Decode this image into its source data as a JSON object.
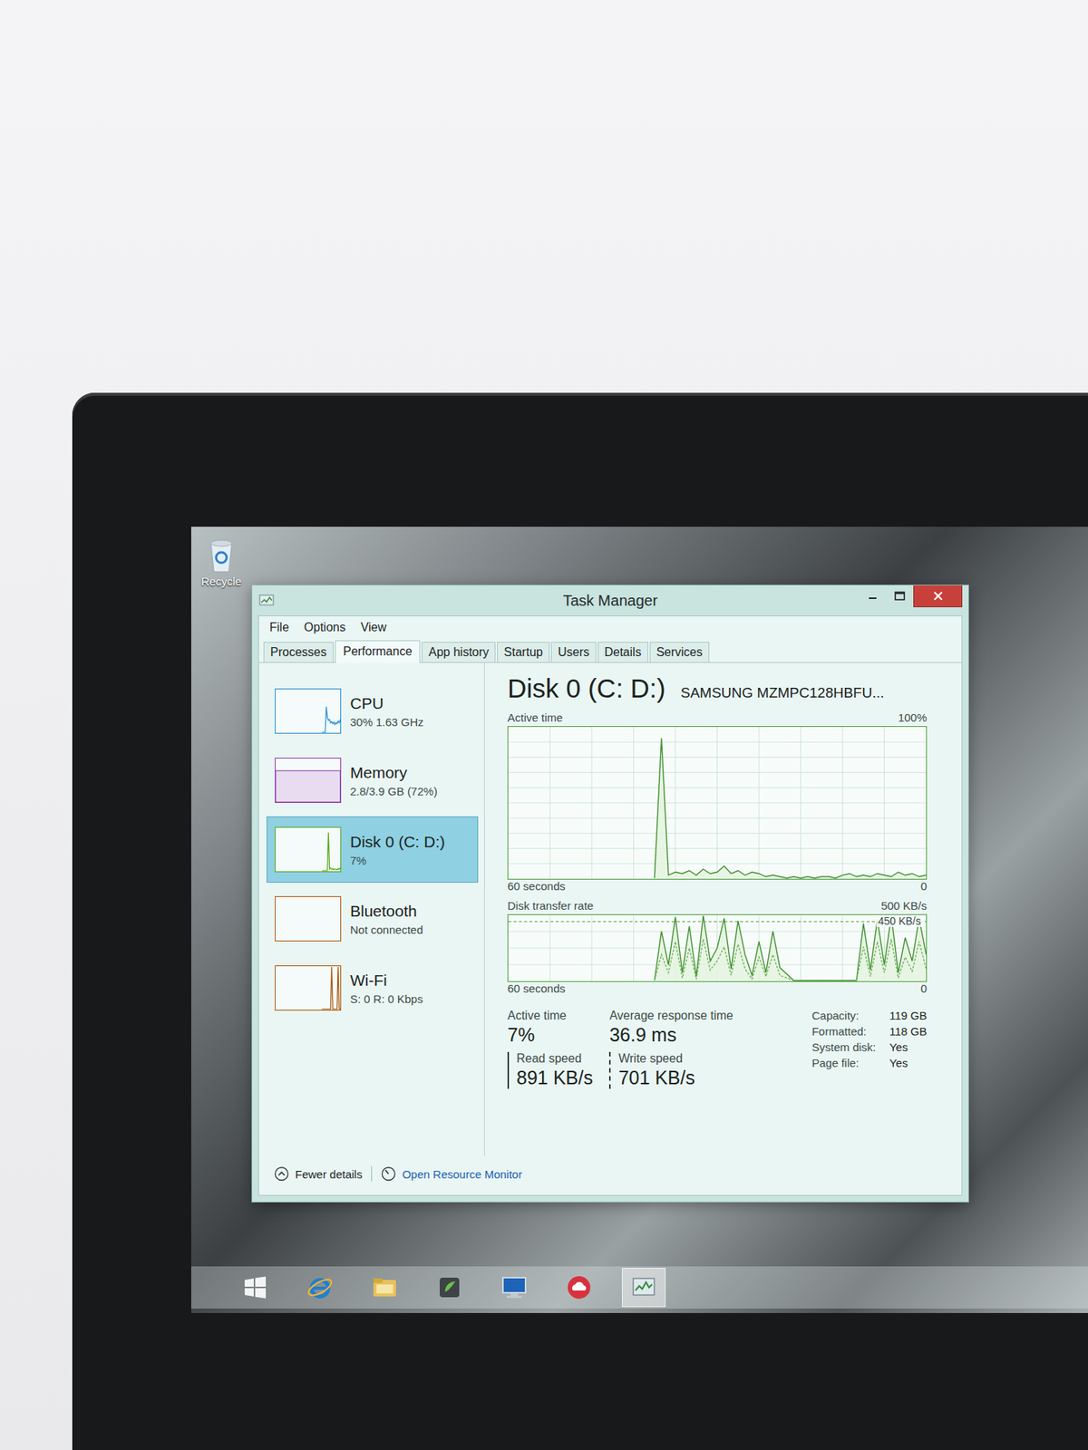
{
  "desktop": {
    "icons": [
      {
        "label": "Recycle"
      }
    ]
  },
  "window": {
    "title": "Task Manager",
    "controls": [
      {
        "kind": "minimize"
      },
      {
        "kind": "maximize"
      },
      {
        "kind": "close"
      }
    ]
  },
  "menu": [
    "File",
    "Options",
    "View"
  ],
  "tabs": [
    {
      "label": "Processes",
      "selected": false
    },
    {
      "label": "Performance",
      "selected": true
    },
    {
      "label": "App history",
      "selected": false
    },
    {
      "label": "Startup",
      "selected": false
    },
    {
      "label": "Users",
      "selected": false
    },
    {
      "label": "Details",
      "selected": false
    },
    {
      "label": "Services",
      "selected": false
    }
  ],
  "sidebar": {
    "items": [
      {
        "name": "CPU",
        "detail": "30% 1.63 GHz",
        "selected": false,
        "kind": "line",
        "color": "#1b8ad1",
        "values": [
          0,
          0,
          0,
          0,
          60,
          35,
          28,
          30,
          22,
          25,
          20,
          24,
          18,
          22,
          20,
          26,
          22,
          30
        ]
      },
      {
        "name": "Memory",
        "detail": "2.8/3.9 GB (72%)",
        "selected": false,
        "kind": "fill",
        "color": "#8b2eab",
        "level": 0.72
      },
      {
        "name": "Disk 0 (C: D:)",
        "detail": "7%",
        "selected": true,
        "kind": "line",
        "color": "#4da60c",
        "values": [
          0,
          0,
          0,
          0,
          0,
          0,
          90,
          4,
          6,
          3,
          5,
          2,
          4,
          3,
          2,
          5,
          3,
          7
        ]
      },
      {
        "name": "Bluetooth",
        "detail": "Not connected",
        "selected": false,
        "kind": "empty",
        "color": "#a74f01"
      },
      {
        "name": "Wi-Fi",
        "detail": "S: 0 R: 0 Kbps",
        "selected": false,
        "kind": "line",
        "color": "#a74f01",
        "values": [
          0,
          0,
          0,
          0,
          0,
          0,
          0,
          0,
          0,
          100,
          0,
          0,
          0,
          0,
          0,
          100,
          0,
          0
        ]
      }
    ]
  },
  "detail": {
    "title": "Disk 0 (C: D:)",
    "model": "SAMSUNG MZMPC128HBFU...",
    "charts": [
      {
        "label": "Active time",
        "max_label": "100%",
        "max": 100,
        "x_label": "60 seconds",
        "min_label": "0",
        "rows": 10,
        "series": [
          {
            "kind": "solid",
            "values": [
              0,
              93,
              2,
              4,
              3,
              5,
              2,
              6,
              3,
              4,
              8,
              3,
              5,
              2,
              4,
              3,
              1,
              2,
              1,
              0,
              1,
              0,
              1,
              0,
              1,
              1,
              0,
              2,
              3,
              1,
              2,
              1,
              3,
              2,
              1,
              4,
              2,
              3,
              1,
              2
            ]
          }
        ]
      },
      {
        "label": "Disk transfer rate",
        "max_label": "500 KB/s",
        "max": 500,
        "marker_label": "450 KB/s",
        "marker": 450,
        "x_label": "60 seconds",
        "min_label": "0",
        "rows": 4,
        "series": [
          {
            "kind": "solid",
            "values": [
              0,
              380,
              120,
              490,
              60,
              420,
              30,
              500,
              150,
              250,
              480,
              90,
              460,
              200,
              40,
              300,
              60,
              380,
              100,
              50,
              0,
              0,
              0,
              0,
              0,
              0,
              0,
              0,
              0,
              0,
              440,
              80,
              470,
              120,
              500,
              60,
              330,
              150,
              480,
              200
            ]
          },
          {
            "kind": "dashed",
            "values": [
              0,
              200,
              60,
              300,
              20,
              250,
              10,
              320,
              80,
              150,
              260,
              40,
              280,
              90,
              10,
              180,
              30,
              200,
              40,
              20,
              0,
              0,
              0,
              0,
              0,
              0,
              0,
              0,
              0,
              0,
              260,
              30,
              300,
              60,
              320,
              20,
              180,
              70,
              300,
              90
            ]
          }
        ]
      }
    ],
    "stats": [
      {
        "label": "Active time",
        "value": "7%"
      },
      {
        "label": "Average response time",
        "value": "36.9 ms"
      }
    ],
    "speeds": [
      {
        "label": "Read speed",
        "value": "891 KB/s",
        "kind": "solid"
      },
      {
        "label": "Write speed",
        "value": "701 KB/s",
        "kind": "dashed"
      }
    ],
    "properties": [
      {
        "label": "Capacity:",
        "value": "119 GB"
      },
      {
        "label": "Formatted:",
        "value": "118 GB"
      },
      {
        "label": "System disk:",
        "value": "Yes"
      },
      {
        "label": "Page file:",
        "value": "Yes"
      }
    ]
  },
  "footer": {
    "less": "Fewer details",
    "link": "Open Resource Monitor"
  },
  "taskbar": [
    {
      "kind": "start",
      "selected": false
    },
    {
      "kind": "ie",
      "selected": false
    },
    {
      "kind": "explorer",
      "selected": false
    },
    {
      "kind": "app",
      "selected": false
    },
    {
      "kind": "lenovo",
      "selected": false
    },
    {
      "kind": "cloud",
      "selected": false
    },
    {
      "kind": "taskmgr",
      "selected": true
    }
  ]
}
